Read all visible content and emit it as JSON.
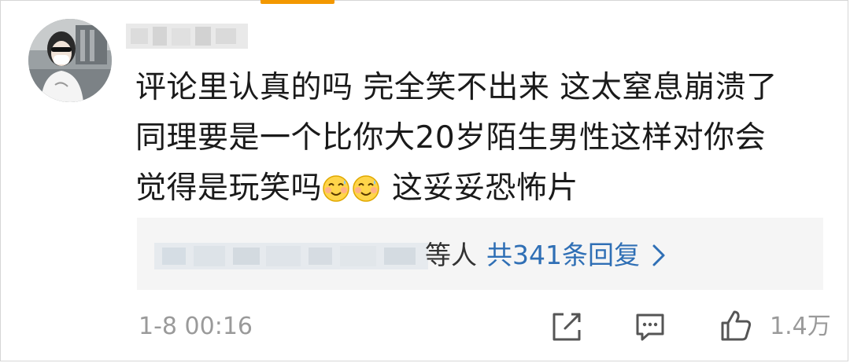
{
  "comment": {
    "lines": [
      "评论里认真的吗 完全笑不出来 这太窒息崩溃了",
      "同理要是一个比你大20岁陌生男性这样对你会",
      "觉得是玩笑吗"
    ],
    "line3_suffix": " 这妥妥恐怖片",
    "emoji_name": "smiling-sweat-emoji"
  },
  "replies": {
    "etc_label": "等人",
    "count_label": "共341条回复",
    "chevron_icon": "chevron-right-icon"
  },
  "footer": {
    "timestamp": "1-8 00:16",
    "share_icon": "edit-share-icon",
    "comment_icon": "comment-bubble-icon",
    "like_icon": "thumbs-up-icon",
    "like_count": "1.4万"
  },
  "colors": {
    "accent": "#f39800",
    "link": "#2f6fb5",
    "muted": "#9a9a9a",
    "reply_bg": "#f5f5f5"
  }
}
